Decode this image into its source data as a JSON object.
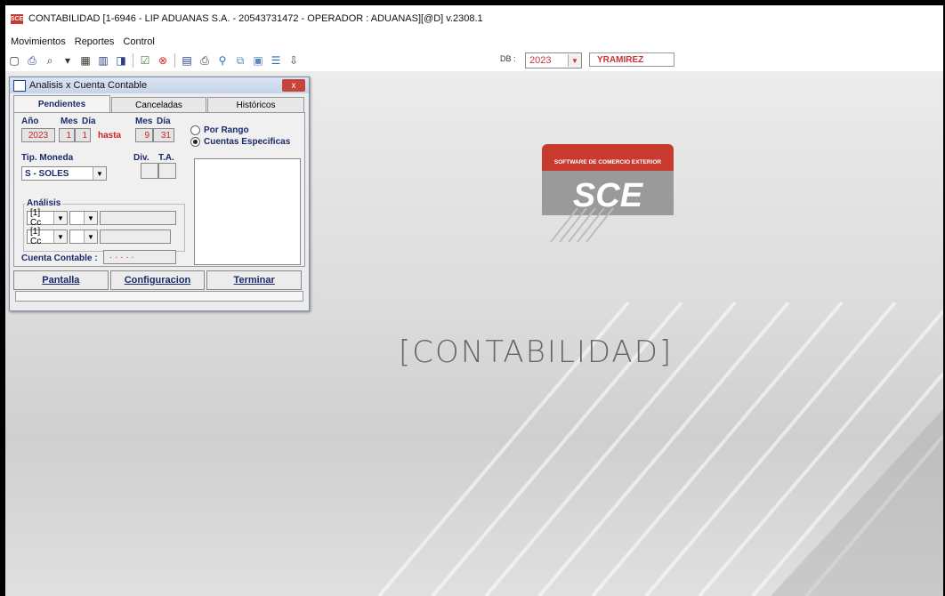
{
  "window": {
    "title": "CONTABILIDAD [1-6946 - LIP ADUANAS S.A. - 20543731472  - OPERADOR : ADUANAS][@D] v.2308.1",
    "icon_text": "SCE"
  },
  "menu": {
    "items": [
      "Movimientos",
      "Reportes",
      "Control"
    ]
  },
  "toolbar": {
    "icons": [
      "new-icon",
      "print-icon",
      "find-icon",
      "filter-icon",
      "grid-icon",
      "table-icon",
      "preview-icon",
      "check-icon",
      "cancel-icon",
      "report-icon",
      "printer-icon",
      "search-icon",
      "copy-icon",
      "export-icon",
      "list-icon",
      "exit-icon"
    ],
    "db_label": "DB :",
    "db_value": "2023",
    "user": "YRAMIREZ"
  },
  "colors": {
    "accent_red": "#c22222",
    "label_blue": "#1a2a6a",
    "logo_red": "#c8392e"
  },
  "dialog": {
    "title": "Analisis x Cuenta Contable",
    "close_label": "x",
    "tabs": [
      "Pendientes",
      "Canceladas",
      "Históricos"
    ],
    "active_tab": "Pendientes",
    "labels": {
      "anio": "Año",
      "mes": "Mes",
      "dia": "Día",
      "hasta": "hasta",
      "mes2": "Mes",
      "dia2": "Día",
      "tip_moneda": "Tip. Moneda",
      "div": "Div.",
      "ta": "T.A.",
      "analisis": "Análisis",
      "cuenta_contable": "Cuenta Contable :"
    },
    "values": {
      "anio": "2023",
      "mes_desde": "1",
      "dia_desde": "1",
      "mes_hasta": "9",
      "dia_hasta": "31",
      "moneda": "S - SOLES",
      "analisis1": "[1] Cc",
      "analisis2": "[1] Cc",
      "cuenta": "· · · · ·"
    },
    "radios": [
      {
        "label": "Por Rango",
        "checked": false
      },
      {
        "label": "Cuentas Especificas",
        "checked": true
      }
    ],
    "buttons": [
      "Pantalla",
      "Configuracion",
      "Terminar"
    ]
  },
  "background": {
    "logo_subtitle": "SOFTWARE DE COMERCIO EXTERIOR",
    "logo_text": "SCE",
    "module_text": "CONTABILIDAD"
  }
}
